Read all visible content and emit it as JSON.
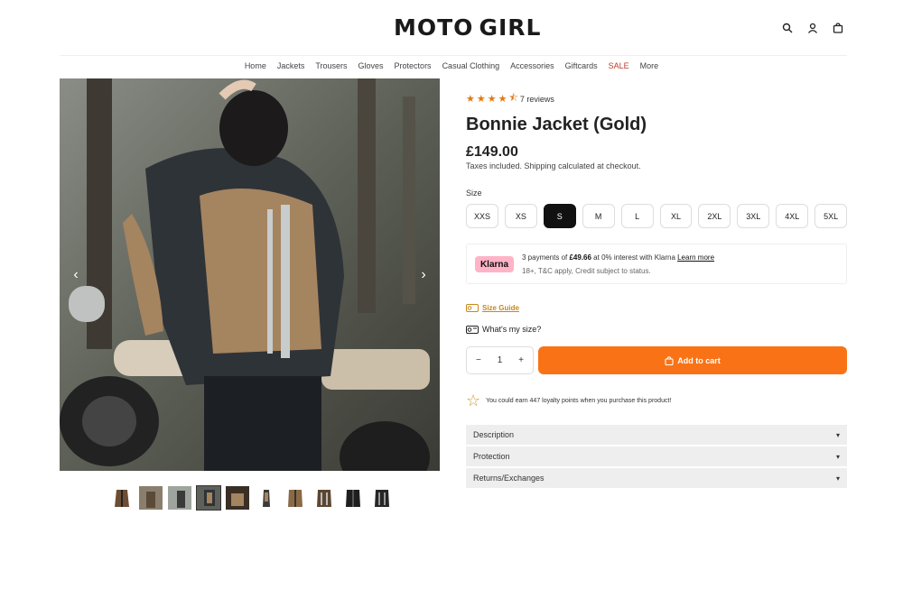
{
  "brand": {
    "left": "MOTO",
    "right": "GIRL"
  },
  "header_icons": [
    "search-icon",
    "user-icon",
    "bag-icon"
  ],
  "nav": {
    "items": [
      "Home",
      "Jackets",
      "Trousers",
      "Gloves",
      "Protectors",
      "Casual Clothing",
      "Accessories",
      "Giftcards"
    ],
    "sale": "SALE",
    "more": "More"
  },
  "gallery": {
    "thumbnail_count": 10,
    "active_index": 3
  },
  "product": {
    "rating": 4.5,
    "reviews": "7 reviews",
    "title": "Bonnie Jacket (Gold)",
    "price": "£149.00",
    "taxes": "Taxes included. Shipping calculated at checkout.",
    "size_label": "Size",
    "sizes": [
      "XXS",
      "XS",
      "S",
      "M",
      "L",
      "XL",
      "2XL",
      "3XL",
      "4XL",
      "5XL"
    ],
    "selected_size": "S"
  },
  "klarna": {
    "badge": "Klarna",
    "line1_prefix": "3 payments of ",
    "amount": "£49.66",
    "line1_suffix": " at 0% interest with Klarna ",
    "learn_more": "Learn more",
    "line2": "18+, T&C apply, Credit subject to status."
  },
  "size_guide": "Size Guide",
  "whats_my_size": "What's my size?",
  "quantity": {
    "value": "1",
    "minus": "−",
    "plus": "+"
  },
  "add_to_cart": "Add to cart",
  "loyalty": "You could earn 447 loyalty points when you purchase this product!",
  "accordion": [
    "Description",
    "Protection",
    "Returns/Exchanges"
  ],
  "colors": {
    "accent": "#f97316",
    "klarna": "#ffb3c7",
    "star": "#e07a14",
    "sale": "#c0392b"
  }
}
